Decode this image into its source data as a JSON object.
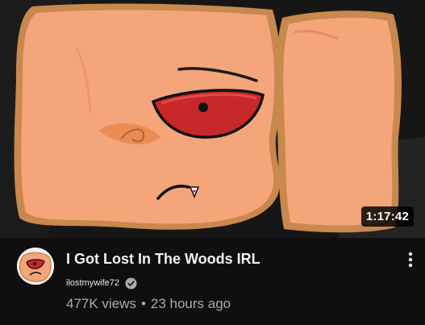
{
  "video": {
    "title": "I Got Lost In The Woods IRL",
    "duration": "1:17:42",
    "thumbnail_icon": "cartoon-character-face-closeup"
  },
  "channel": {
    "name": "ilostmywife72",
    "verified_icon": "verified-check-icon",
    "avatar_icon": "channel-avatar-cartoon"
  },
  "stats": {
    "views": "477K views",
    "separator": "•",
    "age": "23 hours ago"
  },
  "menu": {
    "icon": "kebab-menu-icon"
  },
  "colors": {
    "background": "#0f0f0f",
    "title": "#f1f1f1",
    "secondary_text": "#aaaaaa",
    "skin": "#f4a57a",
    "outline": "#c9884e",
    "eye_red": "#c9282a"
  }
}
